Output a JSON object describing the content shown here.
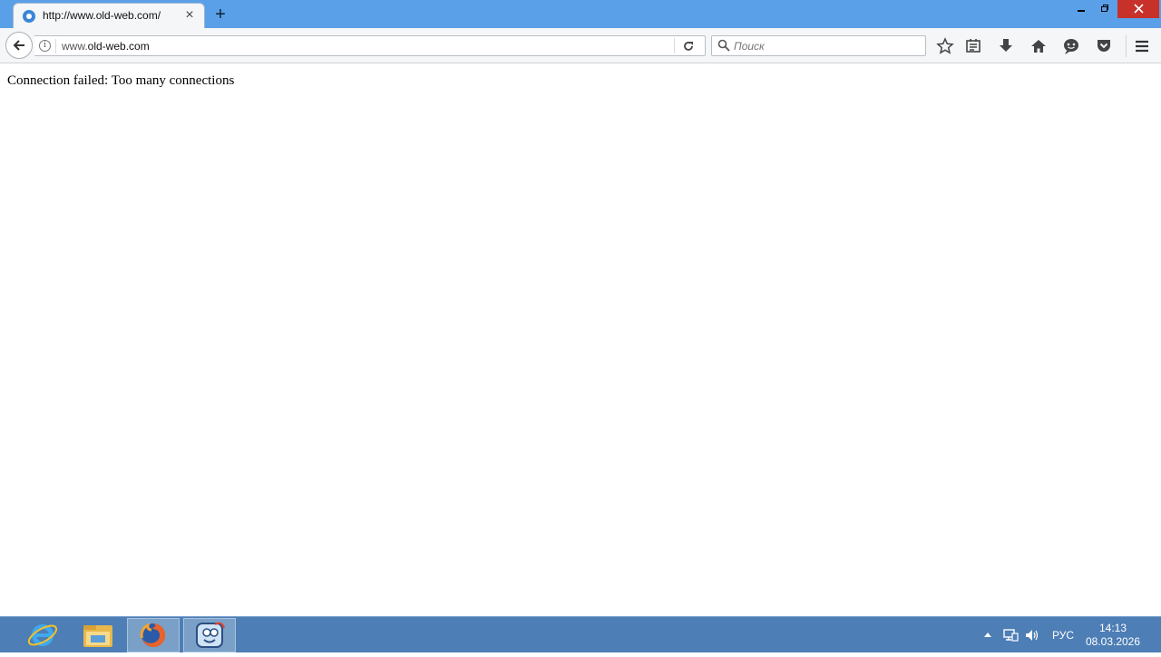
{
  "browser": {
    "tab": {
      "title": "http://www.old-web.com/",
      "favicon": "globe-icon"
    },
    "window_controls": {
      "minimize": "minimize-icon",
      "maximize": "restore-icon",
      "close": "close-icon"
    },
    "url": {
      "host_prefix": "www.",
      "domain": "old-web.com"
    },
    "search": {
      "placeholder": "Поиск"
    },
    "toolbar_icons": [
      "bookmark-star-icon",
      "reading-list-icon",
      "download-icon",
      "home-icon",
      "chat-icon",
      "pocket-icon",
      "menu-icon"
    ]
  },
  "page": {
    "message": "Connection failed: Too many connections"
  },
  "taskbar": {
    "apps": [
      "internet-explorer-icon",
      "file-explorer-icon",
      "firefox-icon",
      "app-icon"
    ],
    "tray": {
      "language": "РУС",
      "time": "14:13",
      "date": "08.03.2026"
    }
  },
  "colors": {
    "titlebar": "#5aa0e8",
    "taskbar": "#4d7eb5",
    "close_button": "#c7312a"
  }
}
